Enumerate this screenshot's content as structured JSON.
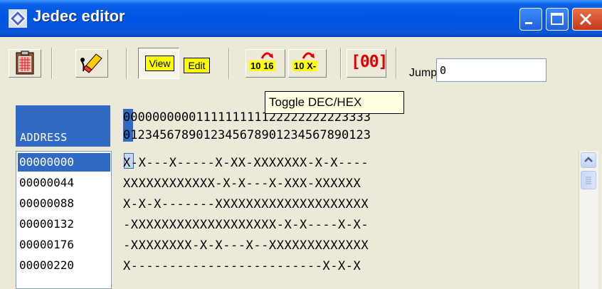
{
  "window": {
    "title": "Jedec editor",
    "icons": {
      "app": "jedec-diamond-icon",
      "minimize": "minimize-icon",
      "maximize": "maximize-icon",
      "close": "close-icon"
    }
  },
  "toolbar": {
    "clipboard_icon": "clipboard-icon",
    "erase_icon": "eraser-icon",
    "view_label": "View",
    "edit_label": "Edit",
    "toggle_1016_label": "10 16",
    "toggle_10x_label": "10 X-",
    "bracket_label": "[00]",
    "jump_label": "Jump",
    "jump_value": "0"
  },
  "tooltip": "Toggle DEC/HEX",
  "grid": {
    "address_header": "ADDRESS",
    "column_tens": "0000000000111111111122222222223333",
    "column_units": "0123456789012345678901234567890123",
    "addresses": [
      "00000000",
      "00000044",
      "00000088",
      "00000132",
      "00000176",
      "00000220"
    ],
    "rows": [
      "X-X---X-----X-XX-XXXXXXX-X-X----",
      "XXXXXXXXXXXX-X-X---X-XXX-XXXXXX",
      "X-X-X-------XXXXXXXXXXXXXXXXXXXX",
      "-XXXXXXXXXXXXXXXXXXX-X-X----X-X-",
      "-XXXXXXXX-X-X---X--XXXXXXXXXXXXX",
      "X-------------------------X-X-X"
    ]
  },
  "colors": {
    "title_bar": "#0054e3",
    "selection": "#316ac5",
    "tooltip_bg": "#ffffe1",
    "toolbar_yellow": "#ffff00",
    "red_icon": "#e00000"
  }
}
